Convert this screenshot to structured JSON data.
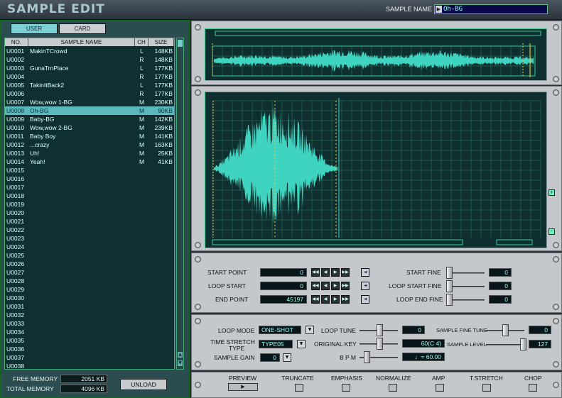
{
  "window": {
    "title": "SAMPLE EDIT"
  },
  "header": {
    "sample_name_label": "SAMPLE NAME",
    "sample_name_value": "Oh-BG"
  },
  "tabs": [
    {
      "label": "USER",
      "active": true
    },
    {
      "label": "CARD",
      "active": false
    }
  ],
  "list": {
    "headers": {
      "no": "NO.",
      "name": "SAMPLE NAME",
      "ch": "CH",
      "size": "SIZE"
    },
    "rows": [
      {
        "no": "U0001",
        "name": "MakinTCrowd",
        "ch": "L",
        "size": "148KB"
      },
      {
        "no": "U0002",
        "name": "",
        "ch": "R",
        "size": "148KB"
      },
      {
        "no": "U0003",
        "name": "GunaTrnPlace",
        "ch": "L",
        "size": "177KB"
      },
      {
        "no": "U0004",
        "name": "",
        "ch": "R",
        "size": "177KB"
      },
      {
        "no": "U0005",
        "name": "TakinItBack2",
        "ch": "L",
        "size": "177KB"
      },
      {
        "no": "U0006",
        "name": "",
        "ch": "R",
        "size": "177KB"
      },
      {
        "no": "U0007",
        "name": "Wow,wow 1-BG",
        "ch": "M",
        "size": "230KB"
      },
      {
        "no": "U0008",
        "name": "Oh-BG",
        "ch": "M",
        "size": "90KB",
        "selected": true
      },
      {
        "no": "U0009",
        "name": "Baby-BG",
        "ch": "M",
        "size": "142KB"
      },
      {
        "no": "U0010",
        "name": "Wow,wow 2-BG",
        "ch": "M",
        "size": "239KB"
      },
      {
        "no": "U0011",
        "name": "Baby Boy",
        "ch": "M",
        "size": "141KB"
      },
      {
        "no": "U0012",
        "name": "...crazy",
        "ch": "M",
        "size": "163KB"
      },
      {
        "no": "U0013",
        "name": "Uh!",
        "ch": "M",
        "size": "25KB"
      },
      {
        "no": "U0014",
        "name": "Yeah!",
        "ch": "M",
        "size": "41KB"
      },
      {
        "no": "U0015",
        "name": "",
        "ch": "",
        "size": ""
      },
      {
        "no": "U0016",
        "name": "",
        "ch": "",
        "size": ""
      },
      {
        "no": "U0017",
        "name": "",
        "ch": "",
        "size": ""
      },
      {
        "no": "U0018",
        "name": "",
        "ch": "",
        "size": ""
      },
      {
        "no": "U0019",
        "name": "",
        "ch": "",
        "size": ""
      },
      {
        "no": "U0020",
        "name": "",
        "ch": "",
        "size": ""
      },
      {
        "no": "U0021",
        "name": "",
        "ch": "",
        "size": ""
      },
      {
        "no": "U0022",
        "name": "",
        "ch": "",
        "size": ""
      },
      {
        "no": "U0023",
        "name": "",
        "ch": "",
        "size": ""
      },
      {
        "no": "U0024",
        "name": "",
        "ch": "",
        "size": ""
      },
      {
        "no": "U0025",
        "name": "",
        "ch": "",
        "size": ""
      },
      {
        "no": "U0026",
        "name": "",
        "ch": "",
        "size": ""
      },
      {
        "no": "U0027",
        "name": "",
        "ch": "",
        "size": ""
      },
      {
        "no": "U0028",
        "name": "",
        "ch": "",
        "size": ""
      },
      {
        "no": "U0029",
        "name": "",
        "ch": "",
        "size": ""
      },
      {
        "no": "U0030",
        "name": "",
        "ch": "",
        "size": ""
      },
      {
        "no": "U0031",
        "name": "",
        "ch": "",
        "size": ""
      },
      {
        "no": "U0032",
        "name": "",
        "ch": "",
        "size": ""
      },
      {
        "no": "U0033",
        "name": "",
        "ch": "",
        "size": ""
      },
      {
        "no": "U0034",
        "name": "",
        "ch": "",
        "size": ""
      },
      {
        "no": "U0035",
        "name": "",
        "ch": "",
        "size": ""
      },
      {
        "no": "U0036",
        "name": "",
        "ch": "",
        "size": ""
      },
      {
        "no": "U0037",
        "name": "",
        "ch": "",
        "size": ""
      },
      {
        "no": "U0038",
        "name": "",
        "ch": "",
        "size": ""
      }
    ]
  },
  "memory": {
    "free_label": "FREE MEMORY",
    "free_value": "2051 KB",
    "total_label": "TOTAL MEMORY",
    "total_value": "4096 KB",
    "unload_label": "UNLOAD"
  },
  "points": {
    "start_label": "START POINT",
    "start_value": "0",
    "loop_start_label": "LOOP START",
    "loop_start_value": "0",
    "end_label": "END POINT",
    "end_value": "45197",
    "start_fine_label": "START FINE",
    "start_fine_value": "0",
    "loop_start_fine_label": "LOOP START FINE",
    "loop_start_fine_value": "0",
    "loop_end_fine_label": "LOOP END FINE",
    "loop_end_fine_value": "0"
  },
  "params": {
    "loop_mode_label": "LOOP MODE",
    "loop_mode_value": "ONE-SHOT",
    "time_stretch_label_1": "TIME STRETCH",
    "time_stretch_label_2": "TYPE",
    "time_stretch_value": "TYPE05",
    "sample_gain_label": "SAMPLE GAIN",
    "sample_gain_value": "0",
    "loop_tune_label": "LOOP TUNE",
    "loop_tune_value": "0",
    "original_key_label": "ORIGINAL KEY",
    "original_key_value": "60(C 4)",
    "bpm_label": "B P M",
    "bpm_value": "♩= 60.00",
    "sample_fine_tune_label": "SAMPLE FINE TUNE",
    "sample_fine_tune_value": "0",
    "sample_level_label": "SAMPLE LEVEL",
    "sample_level_value": "127"
  },
  "actions": {
    "preview": "PREVIEW",
    "truncate": "TRUNCATE",
    "emphasis": "EMPHASIS",
    "normalize": "NORMALIZE",
    "amp": "AMP",
    "tstretch": "T.STRETCH",
    "chop": "CHOP"
  },
  "colors": {
    "waveform": "#3fd4c0",
    "list_bg": "#0f2f31",
    "selected_row": "#5bb8bd",
    "panel": "#c4c8cb"
  }
}
